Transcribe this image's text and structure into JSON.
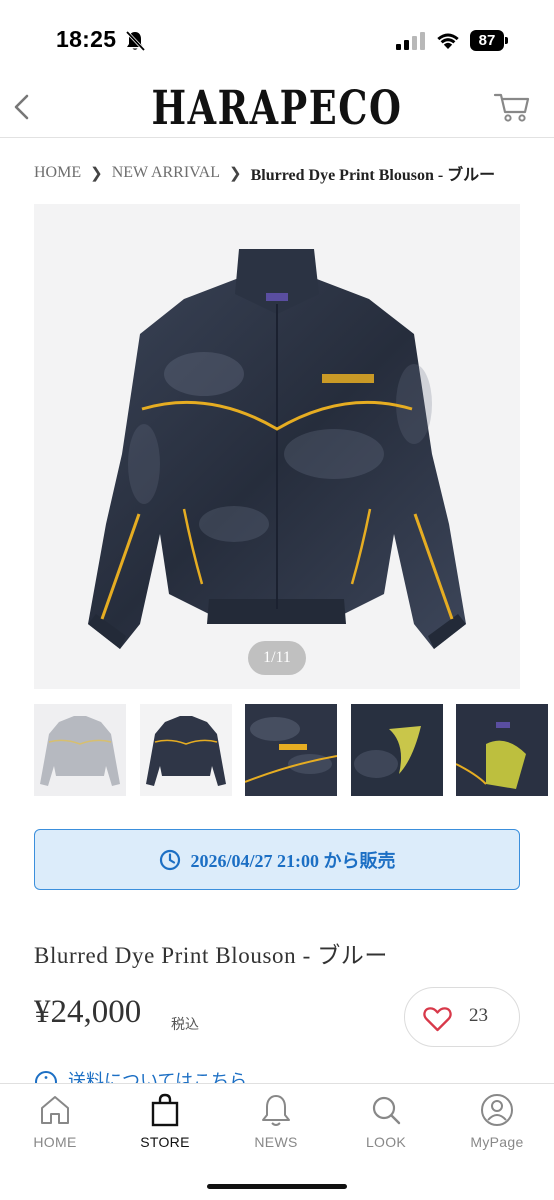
{
  "status_bar": {
    "time": "18:25",
    "battery": "87",
    "icons": [
      "bell-slash-icon",
      "signal-icon",
      "wifi-icon",
      "battery-icon"
    ]
  },
  "header": {
    "brand": "HARAPECO",
    "icons": [
      "back-arrow-icon",
      "cart-icon"
    ]
  },
  "breadcrumb": {
    "items": [
      "HOME",
      "NEW ARRIVAL",
      "Blurred Dye Print Blouson - ブルー"
    ]
  },
  "gallery": {
    "counter": "1/11",
    "thumbnail_count": 5
  },
  "release": {
    "text": "2026/04/27 21:00 から販売",
    "icon": "clock-icon",
    "color": "#1c6fc4",
    "background": "#dcecfa"
  },
  "product": {
    "title": "Blurred Dye Print Blouson - ブルー",
    "price": "¥24,000",
    "tax_label": "税込",
    "likes": "23",
    "shipping_link": "送料についてはこちら"
  },
  "bottom_nav": {
    "items": [
      {
        "label": "HOME",
        "icon": "home-icon"
      },
      {
        "label": "STORE",
        "icon": "shopping-bag-icon",
        "active": true
      },
      {
        "label": "NEWS",
        "icon": "bell-icon"
      },
      {
        "label": "LOOK",
        "icon": "search-icon"
      },
      {
        "label": "MyPage",
        "icon": "user-icon"
      }
    ]
  },
  "colors": {
    "accent_blue": "#1c6fc4",
    "heart_red": "#d8394a",
    "jacket_navy": "#2a3142",
    "piping_yellow": "#e6ad22"
  }
}
